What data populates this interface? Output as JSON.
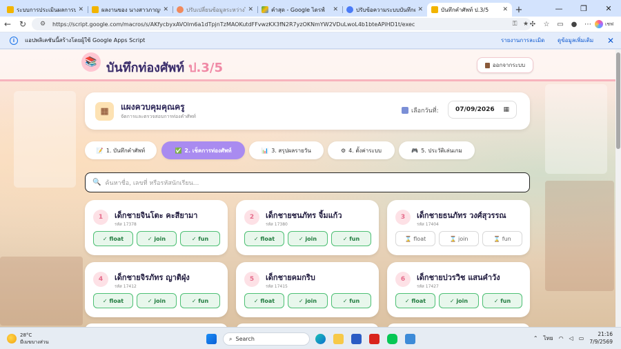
{
  "browser": {
    "tabs": [
      {
        "title": "ระบบการประเมินผลการปฏิบัติงาน",
        "color": "#f2b400"
      },
      {
        "title": "ผลงานของ นางสาวภาญจนา วงศ์",
        "color": "#f2b400"
      },
      {
        "title": "ปรับเปลี่ยนข้อมูลระหว่างไฟล์ - Cl",
        "color": "#f08a5d"
      },
      {
        "title": "คำสุด - Google ไดรฟ์",
        "color": "#34a853"
      },
      {
        "title": "ปรับข้อความระบบบันทึกคำศัพท์",
        "color": "#4a7bf7"
      },
      {
        "title": "บันทึกคำศัพท์ ป.3/5",
        "color": "#f2b400"
      }
    ],
    "url": "https://script.google.com/macros/s/AKfycbyxAVOlm6a1dTpjnTzMAOKutdFFvwzKX3fN2R7yzOKNmYW2VDuLwoL4b1bteAPiHD1t/exec",
    "profile_label": "เชฟ"
  },
  "infobar": {
    "message": "แอปพลิเคชันนี้สร้างโดยผู้ใช้ Google Apps Script",
    "report_link": "รายงานการละเมิด",
    "more_link": "ดูข้อมูลเพิ่มเติม"
  },
  "app": {
    "title": "บันทึกท่องศัพท์",
    "class_label": "ป.3/5",
    "logout_label": "ออกจากระบบ"
  },
  "panel": {
    "title": "แผงควบคุมคุณครู",
    "subtitle": "จัดการและตรวจสอบการท่องคำศัพท์",
    "date_label": "เลือกวันที่:",
    "date_value": "07/09/2026"
  },
  "nav_tabs": [
    {
      "label": "1. บันทึกคำศัพท์",
      "active": false
    },
    {
      "label": "2. เช็คการท่องศัพท์",
      "active": true
    },
    {
      "label": "3. สรุปผลรายวัน",
      "active": false
    },
    {
      "label": "4. ตั้งค่าระบบ",
      "active": false
    },
    {
      "label": "5. ประวัติเล่นเกม",
      "active": false
    }
  ],
  "search": {
    "placeholder": "ค้นหาชื่อ, เลขที่ หรือรหัสนักเรียน..."
  },
  "students": [
    {
      "no": "1",
      "name": "เด็กชายจินโตะ คะสียามา",
      "id": "รหัส 17378",
      "words": [
        {
          "label": "✓ float",
          "done": true
        },
        {
          "label": "✓ join",
          "done": true
        },
        {
          "label": "✓ fun",
          "done": true
        }
      ]
    },
    {
      "no": "2",
      "name": "เด็กชายชนภัทร จิ้มแก้ว",
      "id": "รหัส 17380",
      "words": [
        {
          "label": "✓ float",
          "done": true
        },
        {
          "label": "✓ join",
          "done": true
        },
        {
          "label": "✓ fun",
          "done": true
        }
      ]
    },
    {
      "no": "3",
      "name": "เด็กชายธนภัทร วงศ์สุวรรณ",
      "id": "รหัส 17404",
      "words": [
        {
          "label": "⌛ float",
          "done": false
        },
        {
          "label": "⌛ join",
          "done": false
        },
        {
          "label": "⌛ fun",
          "done": false
        }
      ]
    },
    {
      "no": "4",
      "name": "เด็กชายจิรภัทร ญาติฝุ่ง",
      "id": "รหัส 17412",
      "words": [
        {
          "label": "✓ float",
          "done": true
        },
        {
          "label": "✓ join",
          "done": true
        },
        {
          "label": "✓ fun",
          "done": true
        }
      ]
    },
    {
      "no": "5",
      "name": "เด็กชายคมกริบ",
      "id": "รหัส 17415",
      "words": [
        {
          "label": "✓ float",
          "done": true
        },
        {
          "label": "✓ join",
          "done": true
        },
        {
          "label": "✓ fun",
          "done": true
        }
      ]
    },
    {
      "no": "6",
      "name": "เด็กชายปวรวิช แสนคำวัง",
      "id": "รหัส 17427",
      "words": [
        {
          "label": "✓ float",
          "done": true
        },
        {
          "label": "✓ join",
          "done": true
        },
        {
          "label": "✓ fun",
          "done": true
        }
      ]
    }
  ],
  "taskbar": {
    "weather_temp": "28°C",
    "weather_desc": "มีเมฆบางส่วน",
    "search_label": "Search",
    "lang": "ไทย",
    "time": "21:16",
    "date": "7/9/2569"
  }
}
